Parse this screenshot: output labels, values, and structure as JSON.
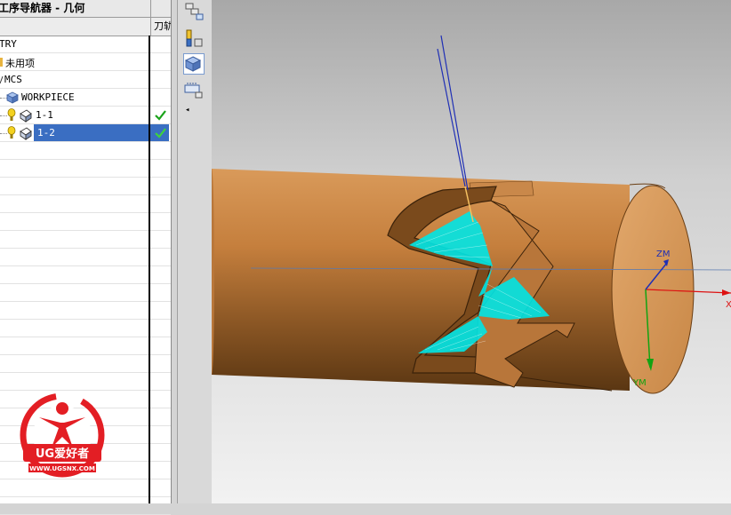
{
  "navigator": {
    "title": "工序导航器 - 几何",
    "column_tool": "刀轨",
    "rows": [
      {
        "label": "GEOMETRY",
        "visible": "TRY"
      },
      {
        "label": "未用项"
      },
      {
        "label": "MCS"
      },
      {
        "label": "WORKPIECE"
      },
      {
        "label": "1-1",
        "status": "ok"
      },
      {
        "label": "1-2",
        "status": "ok",
        "selected": true
      }
    ]
  },
  "toolbar": {
    "buttons": [
      "program-order-view-icon",
      "machine-tool-view-icon",
      "geometry-view-icon",
      "machining-method-view-icon"
    ],
    "active": "geometry-view-icon",
    "collapse_arrow": "◂"
  },
  "viewport": {
    "axis_labels": {
      "zm": "ZM",
      "ym": "YM",
      "xm": "X"
    }
  },
  "watermark": {
    "brand": "UG爱好者",
    "url": "WWW.UGSNX.COM"
  },
  "colors": {
    "selection": "#3a6ec2",
    "part_copper": "#c7803f",
    "toolpath": "#00e5e5",
    "check_green": "#1aa31a",
    "logo_red": "#e31e24"
  }
}
